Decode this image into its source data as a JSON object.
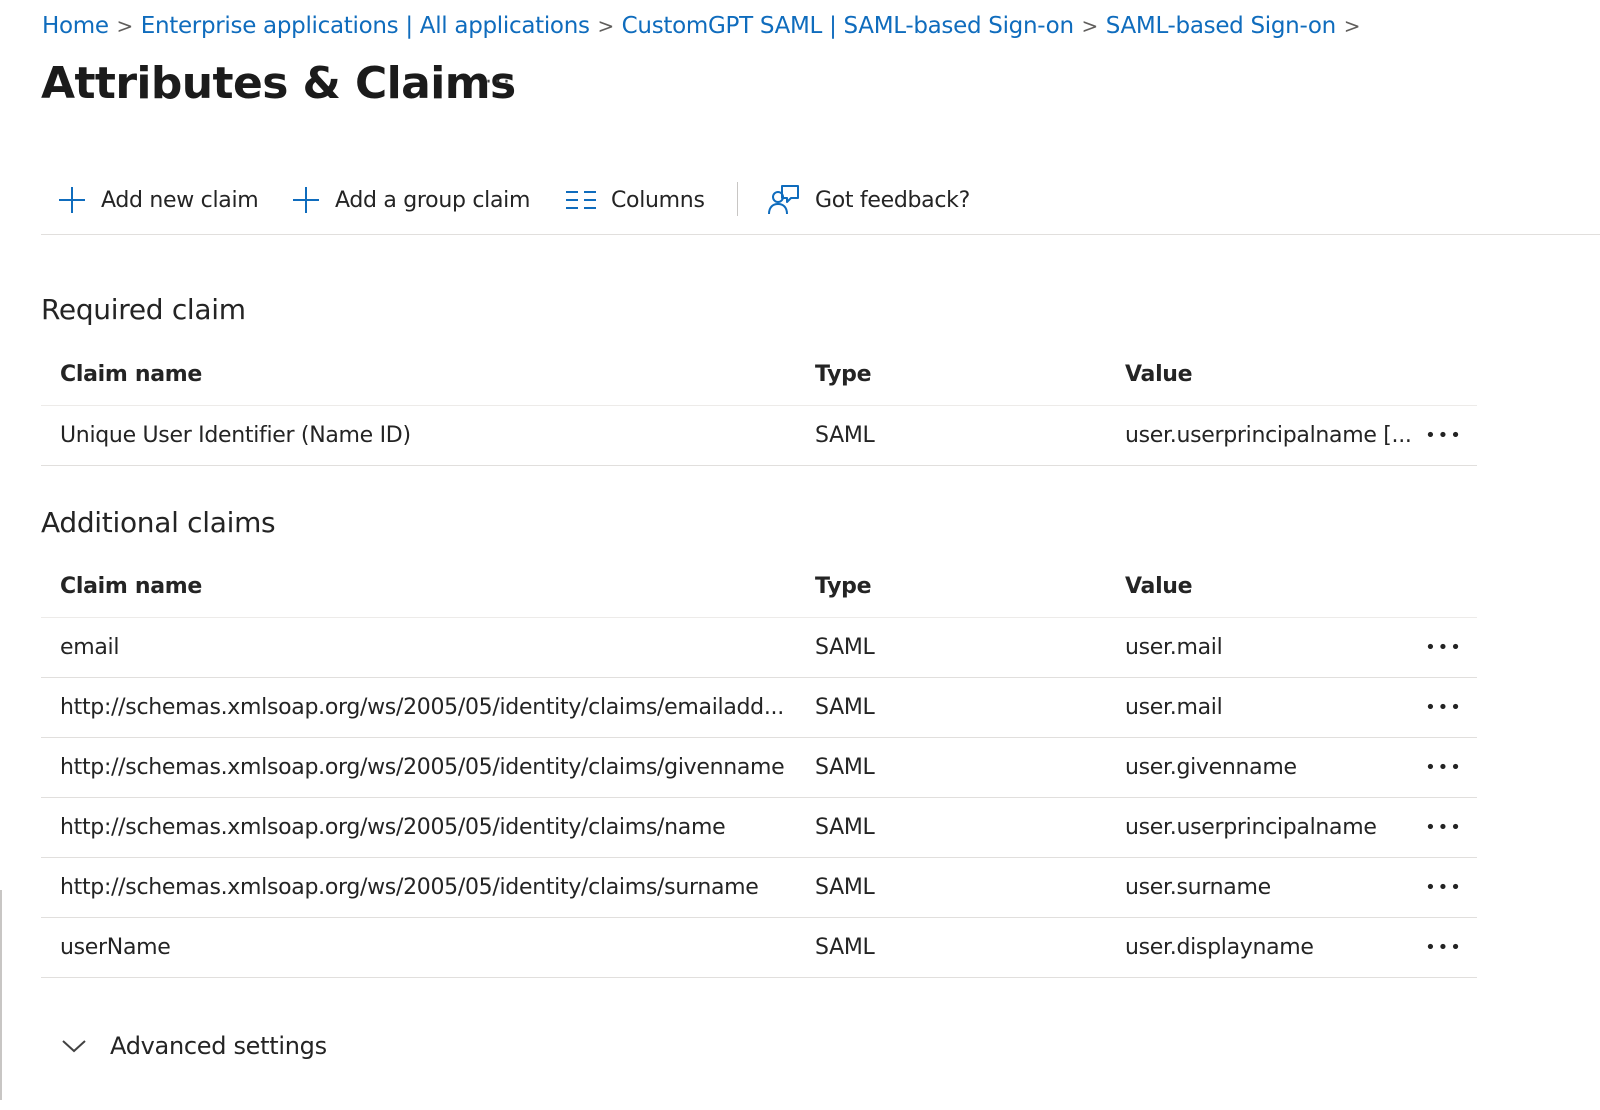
{
  "breadcrumb": {
    "items": [
      "Home",
      "Enterprise applications | All applications",
      "CustomGPT SAML | SAML-based Sign-on",
      "SAML-based Sign-on"
    ],
    "separator": ">"
  },
  "page": {
    "title": "Attributes & Claims",
    "more": "···"
  },
  "toolbar": {
    "add_claim": "Add new claim",
    "add_group_claim": "Add a group claim",
    "columns": "Columns",
    "feedback": "Got feedback?"
  },
  "required": {
    "title": "Required claim",
    "headers": {
      "name": "Claim name",
      "type": "Type",
      "value": "Value"
    },
    "rows": [
      {
        "name": "Unique User Identifier (Name ID)",
        "type": "SAML",
        "value": "user.userprincipalname [..."
      }
    ]
  },
  "additional": {
    "title": "Additional claims",
    "headers": {
      "name": "Claim name",
      "type": "Type",
      "value": "Value"
    },
    "rows": [
      {
        "name": "email",
        "type": "SAML",
        "value": "user.mail"
      },
      {
        "name": "http://schemas.xmlsoap.org/ws/2005/05/identity/claims/emailadd...",
        "type": "SAML",
        "value": "user.mail"
      },
      {
        "name": "http://schemas.xmlsoap.org/ws/2005/05/identity/claims/givenname",
        "type": "SAML",
        "value": "user.givenname"
      },
      {
        "name": "http://schemas.xmlsoap.org/ws/2005/05/identity/claims/name",
        "type": "SAML",
        "value": "user.userprincipalname"
      },
      {
        "name": "http://schemas.xmlsoap.org/ws/2005/05/identity/claims/surname",
        "type": "SAML",
        "value": "user.surname"
      },
      {
        "name": "userName",
        "type": "SAML",
        "value": "user.displayname"
      }
    ]
  },
  "row_more": "•••",
  "advanced": {
    "label": "Advanced settings"
  },
  "colors": {
    "link": "#0f6cbd",
    "text": "#242424",
    "divider": "#e1dfdd"
  }
}
